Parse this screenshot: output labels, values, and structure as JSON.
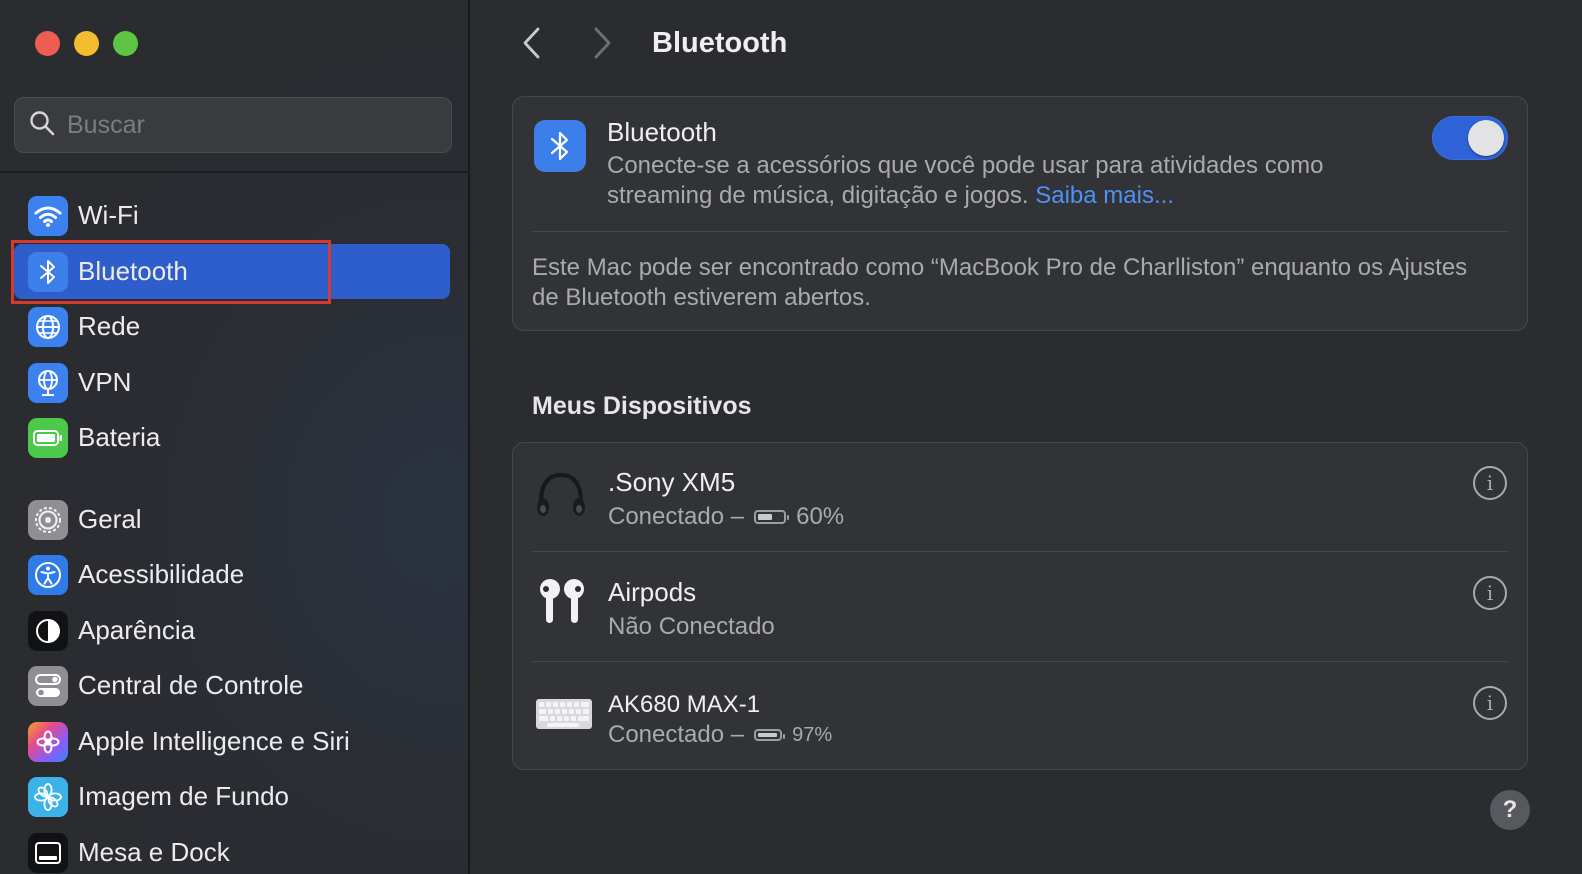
{
  "window": {
    "title": "Bluetooth"
  },
  "search": {
    "placeholder": "Buscar"
  },
  "sidebar": {
    "items": [
      {
        "label": "Wi-Fi",
        "icon": "wifi-icon"
      },
      {
        "label": "Bluetooth",
        "icon": "bluetooth-icon",
        "selected": true
      },
      {
        "label": "Rede",
        "icon": "globe-icon"
      },
      {
        "label": "VPN",
        "icon": "vpn-globe-icon"
      },
      {
        "label": "Bateria",
        "icon": "battery-icon"
      },
      {
        "label": "Geral",
        "icon": "gear-icon"
      },
      {
        "label": "Acessibilidade",
        "icon": "accessibility-icon"
      },
      {
        "label": "Aparência",
        "icon": "appearance-icon"
      },
      {
        "label": "Central de Controle",
        "icon": "control-center-icon"
      },
      {
        "label": "Apple Intelligence e Siri",
        "icon": "siri-icon"
      },
      {
        "label": "Imagem de Fundo",
        "icon": "wallpaper-icon"
      },
      {
        "label": "Mesa e Dock",
        "icon": "dock-icon"
      }
    ]
  },
  "bluetooth": {
    "title": "Bluetooth",
    "description": "Conecte-se a acessórios que você pode usar para atividades como streaming de música, digitação e jogos.",
    "learn_more": "Saiba mais...",
    "enabled": true,
    "discoverable_note": "Este Mac pode ser encontrado como “MacBook Pro de Charlliston” enquanto os Ajustes de Bluetooth estiverem abertos."
  },
  "devices": {
    "section_title": "Meus Dispositivos",
    "list": [
      {
        "name": ".Sony XM5",
        "status": "Conectado –",
        "battery": "60%",
        "battery_level": 0.6,
        "icon": "headphones-icon"
      },
      {
        "name": "Airpods",
        "status": "Não Conectado",
        "icon": "airpods-icon"
      },
      {
        "name": "AK680 MAX-1",
        "status": "Conectado –",
        "battery": "97%",
        "battery_level": 0.97,
        "icon": "keyboard-icon"
      }
    ]
  },
  "help": {
    "label": "?"
  },
  "colors": {
    "accent": "#2e5ecb",
    "toggle_on": "#2e63d8",
    "link": "#4c93f5",
    "highlight": "#d63a2f"
  }
}
